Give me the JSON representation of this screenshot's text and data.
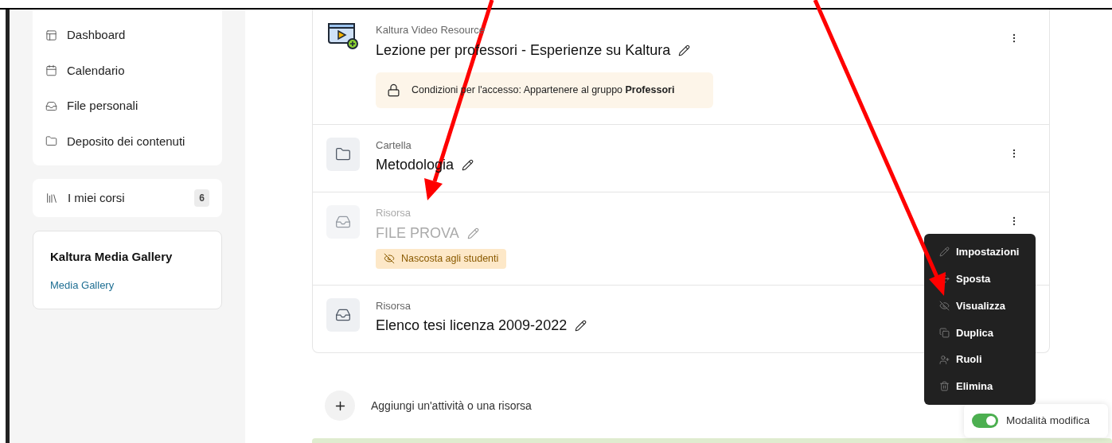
{
  "sidebar": {
    "nav_items": [
      {
        "label": "Dashboard"
      },
      {
        "label": "Calendario"
      },
      {
        "label": "File personali"
      },
      {
        "label": "Deposito dei contenuti"
      }
    ],
    "my_courses": {
      "label": "I miei corsi",
      "count": "6"
    },
    "block": {
      "title": "Kaltura Media Gallery",
      "link": "Media Gallery"
    }
  },
  "activities": [
    {
      "kind": "video",
      "type_label": "Kaltura Video Resource",
      "title": "Lezione per professori - Esperienze su Kaltura",
      "hidden": false,
      "restriction": "Condizioni per l'accesso: Appartenere al gruppo **Professori**"
    },
    {
      "kind": "folder",
      "type_label": "Cartella",
      "title": "Metodologia",
      "hidden": false
    },
    {
      "kind": "resource",
      "type_label": "Risorsa",
      "title": "FILE PROVA",
      "hidden": true,
      "hidden_label": "Nascosta agli studenti"
    },
    {
      "kind": "resource",
      "type_label": "Risorsa",
      "title": "Elenco tesi licenza 2009-2022",
      "hidden": false
    }
  ],
  "add_activity": "Aggiungi un'attività o una risorsa",
  "context_menu": [
    {
      "kind": "edit",
      "label": "Impostazioni"
    },
    {
      "kind": "move",
      "label": "Sposta"
    },
    {
      "kind": "show",
      "label": "Visualizza"
    },
    {
      "kind": "copy",
      "label": "Duplica"
    },
    {
      "kind": "roles",
      "label": "Ruoli"
    },
    {
      "kind": "delete",
      "label": "Elimina"
    }
  ],
  "edit_mode": {
    "label": "Modalità modifica",
    "on": true
  }
}
